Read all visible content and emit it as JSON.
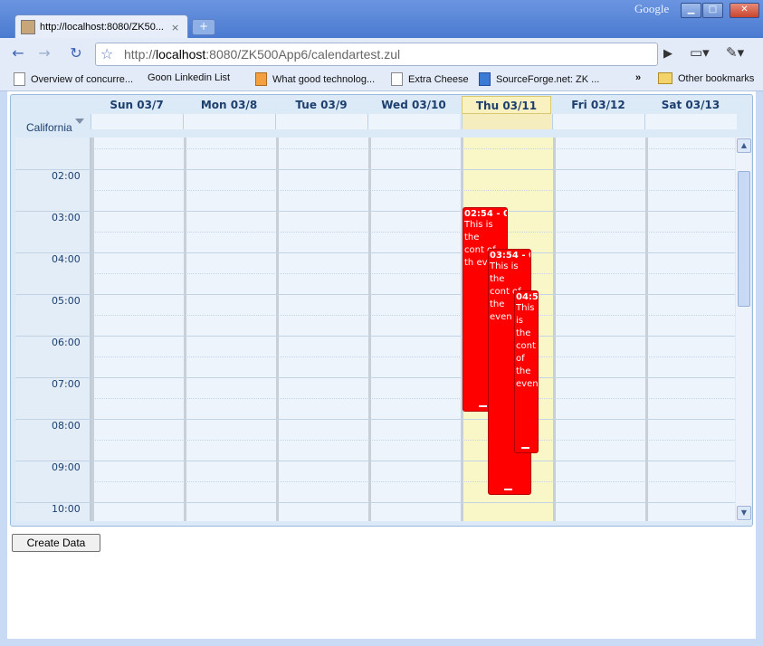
{
  "browser": {
    "tab_title": "http://localhost:8080/ZK50...",
    "tab_close": "×",
    "new_tab": "+",
    "brand": "Google",
    "url_prefix": "http://",
    "url_host": "localhost",
    "url_rest": ":8080/ZK500App6/calendartest.zul",
    "bookmarks": [
      "Overview of concurre...",
      "Goon Linkedin List",
      "What good technolog...",
      "Extra Cheese",
      "SourceForge.net: ZK ..."
    ],
    "bookmarks_overflow": "»",
    "other_bookmarks": "Other bookmarks"
  },
  "calendar": {
    "timezone": "California",
    "days": [
      {
        "label": "Sun 03/7"
      },
      {
        "label": "Mon 03/8"
      },
      {
        "label": "Tue 03/9"
      },
      {
        "label": "Wed 03/10"
      },
      {
        "label": "Thu 03/11",
        "today": true
      },
      {
        "label": "Fri 03/12"
      },
      {
        "label": "Sat 03/13"
      }
    ],
    "hours": [
      "02:00",
      "03:00",
      "04:00",
      "05:00",
      "06:00",
      "07:00",
      "08:00",
      "09:00",
      "10:00"
    ],
    "events": [
      {
        "time": "02:54 - 0",
        "text": "This is the cont of th even",
        "color": "#ff0000"
      },
      {
        "time": "03:54 - 0",
        "text": "This is the cont of the even",
        "color": "#ff0000"
      },
      {
        "time": "04:5",
        "text": "This is the cont of the even",
        "color": "#ff0000"
      }
    ],
    "today_color": "#f9f6c8"
  },
  "actions": {
    "create_data": "Create Data"
  }
}
